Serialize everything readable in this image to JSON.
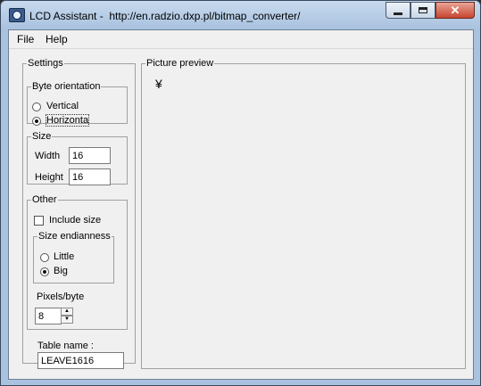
{
  "window": {
    "title": "LCD Assistant -  http://en.radzio.dxp.pl/bitmap_converter/",
    "close_glyph": "✕"
  },
  "menu": {
    "file": "File",
    "help": "Help"
  },
  "settings": {
    "legend": "Settings",
    "byte_orientation": {
      "legend": "Byte orientation",
      "vertical": "Vertical",
      "horizontal": "Horizonta",
      "selected": "horizontal"
    },
    "size": {
      "legend": "Size",
      "width_label": "Width",
      "width_value": "16",
      "height_label": "Height",
      "height_value": "16"
    },
    "other": {
      "legend": "Other",
      "include_size_label": "Include size",
      "include_size_checked": false,
      "endianness": {
        "legend": "Size endianness",
        "little": "Little",
        "big": "Big",
        "selected": "big"
      },
      "pixels_per_byte_label": "Pixels/byte",
      "pixels_per_byte_value": "8"
    },
    "table_name_label": "Table name :",
    "table_name_value": "LEAVE1616"
  },
  "preview": {
    "legend": "Picture preview",
    "glyph": "¥"
  },
  "icons": {
    "app": "lcd-assistant-app-icon",
    "min": "minimize-icon",
    "max": "maximize-icon",
    "close": "close-icon"
  }
}
